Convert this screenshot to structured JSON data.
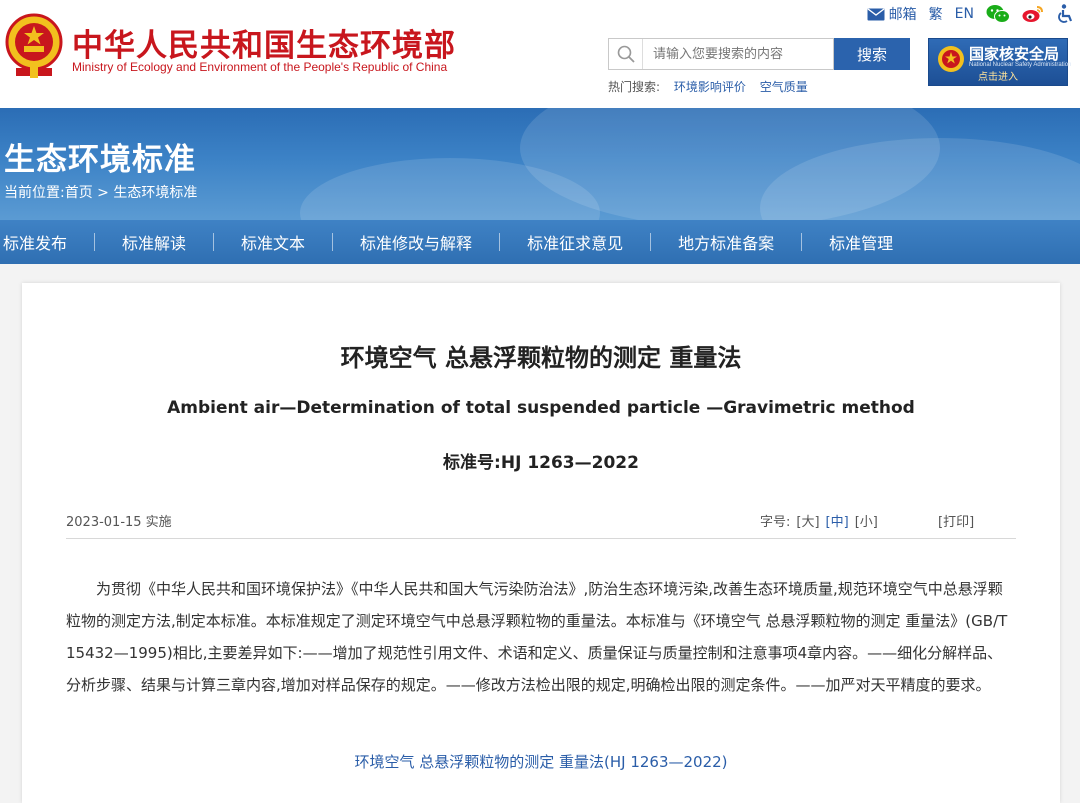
{
  "header": {
    "site_name_cn": "中华人民共和国生态环境部",
    "site_name_en": "Ministry of Ecology and Environment of the People's Republic of China",
    "top_links": {
      "mail": "邮箱",
      "traditional": "繁",
      "english": "EN"
    },
    "search": {
      "placeholder": "请输入您要搜索的内容",
      "button": "搜索"
    },
    "hot_search": {
      "label": "热门搜索:",
      "items": [
        "环境影响评价",
        "空气质量"
      ]
    },
    "nnsa": {
      "name_cn": "国家核安全局",
      "name_en": "National Nuclear Safety Administration",
      "enter": "点击进入"
    }
  },
  "banner": {
    "title": "生态环境标准",
    "breadcrumb": {
      "prefix": "当前位置:",
      "home": "首页",
      "sep": ">",
      "current": "生态环境标准"
    }
  },
  "nav": [
    "标准发布",
    "标准解读",
    "标准文本",
    "标准修改与解释",
    "标准征求意见",
    "地方标准备案",
    "标准管理"
  ],
  "article": {
    "title_cn": "环境空气 总悬浮颗粒物的测定 重量法",
    "title_en": "Ambient air—Determination of total suspended particle —Gravimetric method",
    "standard_no": "标准号:HJ 1263—2022",
    "date": "2023-01-15 实施",
    "font_size_label": "字号:",
    "font_sizes": [
      "[大]",
      "[中]",
      "[小]"
    ],
    "print": "[打印]",
    "body": "为贯彻《中华人民共和国环境保护法》《中华人民共和国大气污染防治法》,防治生态环境污染,改善生态环境质量,规范环境空气中总悬浮颗粒物的测定方法,制定本标准。本标准规定了测定环境空气中总悬浮颗粒物的重量法。本标准与《环境空气 总悬浮颗粒物的测定 重量法》(GB/T 15432—1995)相比,主要差异如下:——增加了规范性引用文件、术语和定义、质量保证与质量控制和注意事项4章内容。——细化分解样品、分析步骤、结果与计算三章内容,增加对样品保存的规定。——修改方法检出限的规定,明确检出限的测定条件。——加严对天平精度的要求。",
    "doc_link": "环境空气 总悬浮颗粒物的测定 重量法(HJ 1263—2022)"
  },
  "colors": {
    "brand_red": "#c8161d",
    "link_blue": "#2a5da8",
    "nav_blue": "#3575b8"
  }
}
